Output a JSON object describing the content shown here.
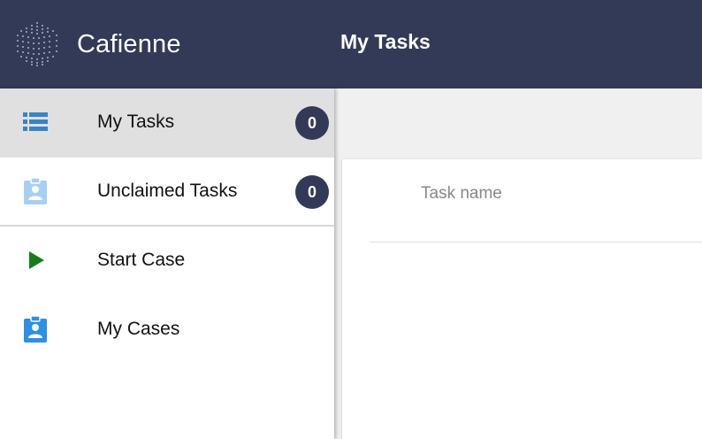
{
  "app": {
    "brand_name": "Cafienne",
    "page_title": "My Tasks"
  },
  "sidebar": {
    "items": [
      {
        "label": "My Tasks",
        "icon": "list-icon",
        "badge": "0",
        "active": true
      },
      {
        "label": "Unclaimed Tasks",
        "icon": "clipboard-user-icon",
        "badge": "0",
        "active": false
      },
      {
        "label": "Start Case",
        "icon": "play-icon",
        "active": false
      },
      {
        "label": "My Cases",
        "icon": "clipboard-user-icon",
        "active": false
      }
    ]
  },
  "task_table": {
    "columns": [
      "Task name"
    ],
    "rows": []
  },
  "colors": {
    "header_bg": "#323a57",
    "active_item_bg": "#e0e0e0",
    "badge_bg": "#323a57",
    "list_icon": "#3b82c4",
    "unclaimed_icon": "#a9cff0",
    "play_icon": "#1a7a1a",
    "my_cases_icon": "#2f8fe0"
  }
}
